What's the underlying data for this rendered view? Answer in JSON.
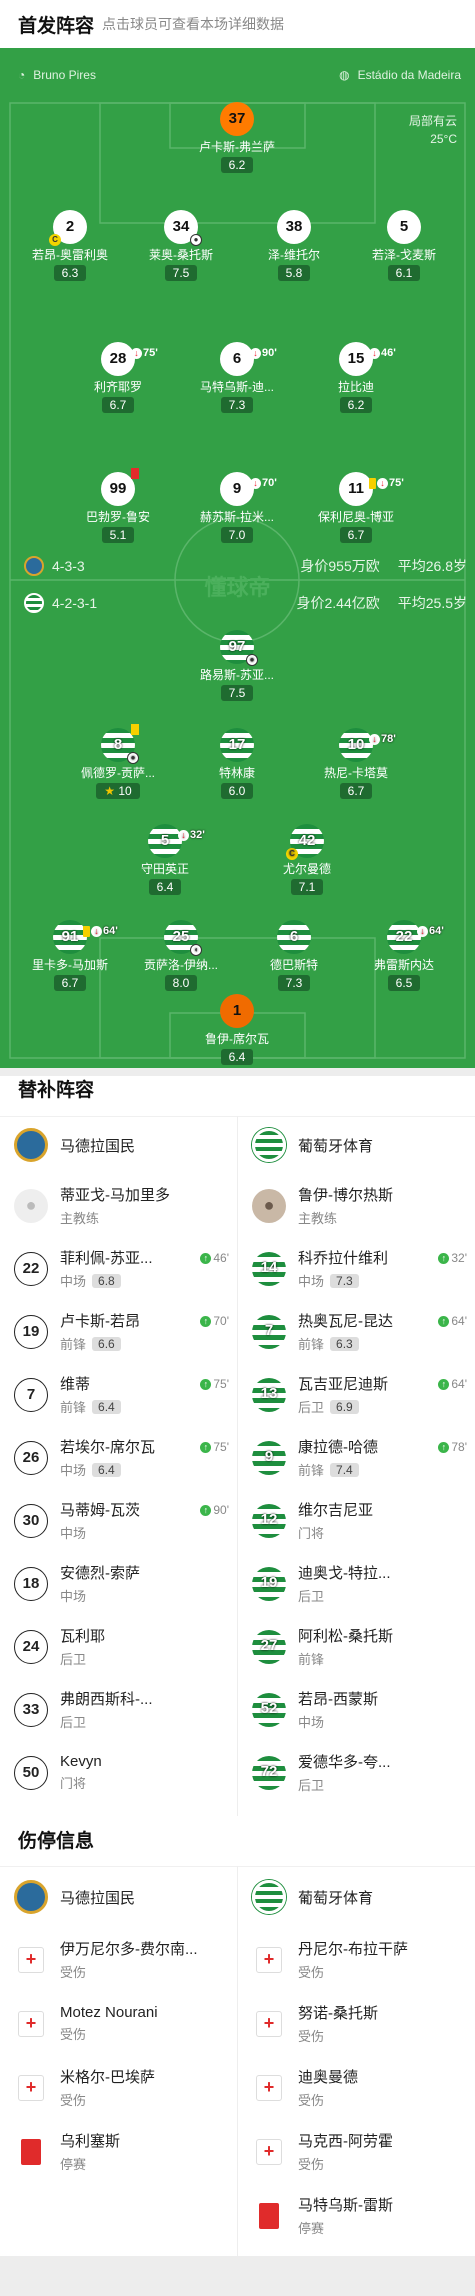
{
  "header": {
    "title": "首发阵容",
    "subtitle": "点击球员可查看本场详细数据"
  },
  "pitch": {
    "referee": "Bruno Pires",
    "venue": "Estádio da Madeira",
    "weather_line1": "局部有云",
    "weather_line2": "25°C",
    "watermark": "懂球帝"
  },
  "home_team": {
    "formation": "4-3-3",
    "value": "身价955万欧",
    "age": "平均26.8岁"
  },
  "away_team": {
    "formation": "4-2-3-1",
    "value": "身价2.44亿欧",
    "age": "平均25.5岁"
  },
  "home_players": [
    {
      "num": "37",
      "name": "卢卡斯-弗兰萨",
      "rating": "6.2"
    },
    {
      "num": "2",
      "name": "若昂-奥雷利奥",
      "rating": "6.3"
    },
    {
      "num": "34",
      "name": "莱奥-桑托斯",
      "rating": "7.5"
    },
    {
      "num": "38",
      "name": "泽-维托尔",
      "rating": "5.8"
    },
    {
      "num": "5",
      "name": "若泽-戈麦斯",
      "rating": "6.1"
    },
    {
      "num": "28",
      "name": "利齐耶罗",
      "rating": "6.7",
      "sub": "75'"
    },
    {
      "num": "6",
      "name": "马特乌斯-迪...",
      "rating": "7.3",
      "sub": "90'"
    },
    {
      "num": "15",
      "name": "拉比迪",
      "rating": "6.2",
      "sub": "46'"
    },
    {
      "num": "99",
      "name": "巴勃罗-鲁安",
      "rating": "5.1",
      "sub": ""
    },
    {
      "num": "9",
      "name": "赫苏斯-拉米...",
      "rating": "7.0",
      "sub": "70'"
    },
    {
      "num": "11",
      "name": "保利尼奥-博亚",
      "rating": "6.7",
      "sub": "75'"
    }
  ],
  "away_players": [
    {
      "num": "97",
      "name": "路易斯-苏亚...",
      "rating": "7.5"
    },
    {
      "num": "8",
      "name": "佩德罗-贡萨...",
      "rating": "10"
    },
    {
      "num": "17",
      "name": "特林康",
      "rating": "6.0"
    },
    {
      "num": "10",
      "name": "热尼-卡塔莫",
      "rating": "6.7",
      "sub": "78'"
    },
    {
      "num": "5",
      "name": "守田英正",
      "rating": "6.4",
      "sub": "32'"
    },
    {
      "num": "42",
      "name": "尤尔曼德",
      "rating": "7.1"
    },
    {
      "num": "91",
      "name": "里卡多-马加斯",
      "rating": "6.7",
      "sub": "64'"
    },
    {
      "num": "25",
      "name": "贡萨洛-伊纳...",
      "rating": "8.0"
    },
    {
      "num": "6",
      "name": "德巴斯特",
      "rating": "7.3"
    },
    {
      "num": "22",
      "name": "弗雷斯内达",
      "rating": "6.5",
      "sub": "64'"
    },
    {
      "num": "1",
      "name": "鲁伊-席尔瓦",
      "rating": "6.4"
    }
  ],
  "subs": {
    "title": "替补阵容",
    "home_name": "马德拉国民",
    "away_name": "葡萄牙体育",
    "home_coach": {
      "name": "蒂亚戈-马加里多",
      "role": "主教练"
    },
    "away_coach": {
      "name": "鲁伊-博尔热斯",
      "role": "主教练"
    },
    "home": [
      {
        "num": "22",
        "name": "菲利佩-苏亚...",
        "pos": "中场",
        "rating": "6.8",
        "ev": "46'"
      },
      {
        "num": "19",
        "name": "卢卡斯-若昂",
        "pos": "前锋",
        "rating": "6.6",
        "ev": "70'"
      },
      {
        "num": "7",
        "name": "维蒂",
        "pos": "前锋",
        "rating": "6.4",
        "ev": "75'"
      },
      {
        "num": "26",
        "name": "若埃尔-席尔瓦",
        "pos": "中场",
        "rating": "6.4",
        "ev": "75'"
      },
      {
        "num": "30",
        "name": "马蒂姆-瓦茨",
        "pos": "中场",
        "rating": "",
        "ev": "90'"
      },
      {
        "num": "18",
        "name": "安德烈-索萨",
        "pos": "中场",
        "rating": "",
        "ev": ""
      },
      {
        "num": "24",
        "name": "瓦利耶",
        "pos": "后卫",
        "rating": "",
        "ev": ""
      },
      {
        "num": "33",
        "name": "弗朗西斯科-...",
        "pos": "后卫",
        "rating": "",
        "ev": ""
      },
      {
        "num": "50",
        "name": "Kevyn",
        "pos": "门将",
        "rating": "",
        "ev": ""
      }
    ],
    "away": [
      {
        "num": "14",
        "name": "科乔拉什维利",
        "pos": "中场",
        "rating": "7.3",
        "ev": "32'"
      },
      {
        "num": "7",
        "name": "热奥瓦尼-昆达",
        "pos": "前锋",
        "rating": "6.3",
        "ev": "64'"
      },
      {
        "num": "13",
        "name": "瓦吉亚尼迪斯",
        "pos": "后卫",
        "rating": "6.9",
        "ev": "64'"
      },
      {
        "num": "9",
        "name": "康拉德-哈德",
        "pos": "前锋",
        "rating": "7.4",
        "ev": "78'"
      },
      {
        "num": "12",
        "name": "维尔吉尼亚",
        "pos": "门将",
        "rating": "",
        "ev": ""
      },
      {
        "num": "19",
        "name": "迪奥戈-特拉...",
        "pos": "后卫",
        "rating": "",
        "ev": ""
      },
      {
        "num": "27",
        "name": "阿利松-桑托斯",
        "pos": "前锋",
        "rating": "",
        "ev": ""
      },
      {
        "num": "52",
        "name": "若昂-西蒙斯",
        "pos": "中场",
        "rating": "",
        "ev": ""
      },
      {
        "num": "72",
        "name": "爱德华多-夸...",
        "pos": "后卫",
        "rating": "",
        "ev": ""
      }
    ]
  },
  "injuries": {
    "title": "伤停信息",
    "home": [
      {
        "name": "伊万尼尔多-费尔南...",
        "status": "受伤",
        "type": "injury"
      },
      {
        "name": "Motez Nourani",
        "status": "受伤",
        "type": "injury"
      },
      {
        "name": "米格尔-巴埃萨",
        "status": "受伤",
        "type": "injury"
      },
      {
        "name": "乌利塞斯",
        "status": "停赛",
        "type": "suspension"
      }
    ],
    "away": [
      {
        "name": "丹尼尔-布拉干萨",
        "status": "受伤",
        "type": "injury"
      },
      {
        "name": "努诺-桑托斯",
        "status": "受伤",
        "type": "injury"
      },
      {
        "name": "迪奥曼德",
        "status": "受伤",
        "type": "injury"
      },
      {
        "name": "马克西-阿劳霍",
        "status": "受伤",
        "type": "injury"
      },
      {
        "name": "马特乌斯-雷斯",
        "status": "停赛",
        "type": "suspension"
      }
    ]
  }
}
